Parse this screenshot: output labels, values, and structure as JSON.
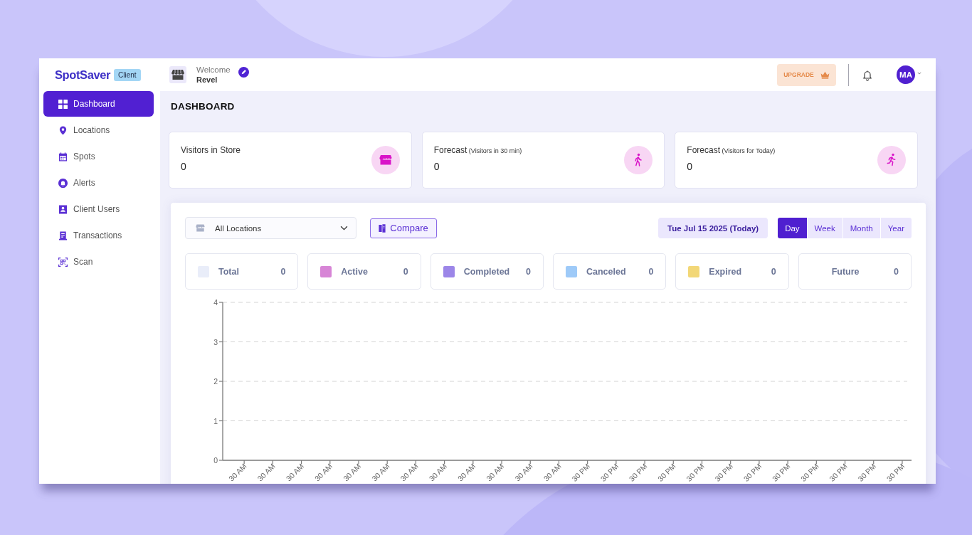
{
  "brand": {
    "name": "SpotSaver",
    "badge": "Client"
  },
  "header": {
    "greeting": "Welcome",
    "user": "Revel",
    "upgrade": "UPGRADE",
    "avatar": "MA"
  },
  "sidebar": {
    "items": [
      {
        "label": "Dashboard",
        "selected": true
      },
      {
        "label": "Locations",
        "selected": false
      },
      {
        "label": "Spots",
        "selected": false
      },
      {
        "label": "Alerts",
        "selected": false
      },
      {
        "label": "Client Users",
        "selected": false
      },
      {
        "label": "Transactions",
        "selected": false
      },
      {
        "label": "Scan",
        "selected": false
      }
    ]
  },
  "page_title": "DASHBOARD",
  "stats": [
    {
      "label": "Visitors in Store",
      "value": "0"
    },
    {
      "label": "Forecast",
      "note": "(Visitors in 30 min)",
      "value": "0"
    },
    {
      "label": "Forecast",
      "note": "(Visitors for Today)",
      "value": "0"
    }
  ],
  "panel": {
    "location_filter": "All Locations",
    "compare_button": "Compare",
    "date_button": "Tue Jul 15 2025 (Today)",
    "periods": [
      {
        "label": "Day",
        "selected": true
      },
      {
        "label": "Week",
        "selected": false
      },
      {
        "label": "Month",
        "selected": false
      },
      {
        "label": "Year",
        "selected": false
      }
    ],
    "legend": [
      {
        "label": "Total",
        "value": "0",
        "color": "#e9edf9"
      },
      {
        "label": "Active",
        "value": "0",
        "color": "#d785d6"
      },
      {
        "label": "Completed",
        "value": "0",
        "color": "#9c86e8"
      },
      {
        "label": "Canceled",
        "value": "0",
        "color": "#9ecaf8"
      },
      {
        "label": "Expired",
        "value": "0",
        "color": "#f2d777"
      },
      {
        "label": "Future",
        "value": "0"
      }
    ],
    "chart_data": {
      "type": "bar",
      "grid": true,
      "categories": [
        "30 AM",
        "30 AM",
        "30 AM",
        "30 AM",
        "30 AM",
        "30 AM",
        "30 AM",
        "30 AM",
        "30 AM",
        "30 AM",
        "30 AM",
        "30 AM",
        "30 PM",
        "30 PM",
        "30 PM",
        "30 PM",
        "30 PM",
        "30 PM",
        "30 PM",
        "30 PM",
        "30 PM",
        "30 PM",
        "30 PM",
        "30 PM"
      ],
      "ylim": [
        0,
        4
      ],
      "yticks": [
        0,
        1,
        2,
        3,
        4
      ]
    }
  }
}
